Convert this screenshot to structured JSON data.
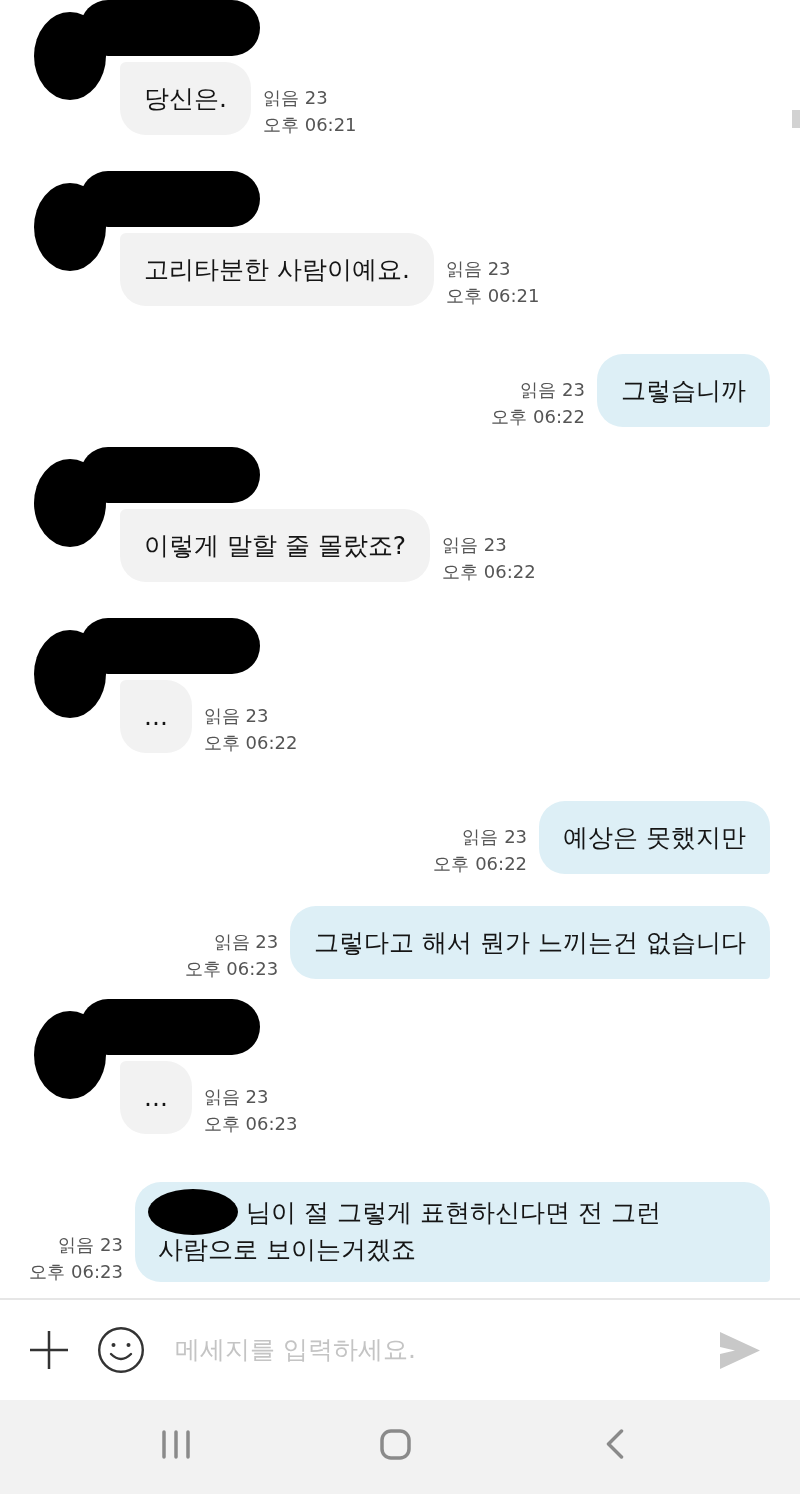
{
  "messages": [
    {
      "kind": "received",
      "lines": [
        "당신은."
      ],
      "read": "읽음 23",
      "time": "오후 06:21",
      "redacted_name_prefix": false
    },
    {
      "kind": "received",
      "lines": [
        "고리타분한 사람이예요."
      ],
      "read": "읽음 23",
      "time": "오후 06:21",
      "redacted_name_prefix": false
    },
    {
      "kind": "sent",
      "lines": [
        "그렇습니까"
      ],
      "read": "읽음 23",
      "time": "오후 06:22",
      "redacted_name_prefix": false
    },
    {
      "kind": "received",
      "lines": [
        "이렇게 말할 줄 몰랐죠?"
      ],
      "read": "읽음 23",
      "time": "오후 06:22",
      "redacted_name_prefix": false
    },
    {
      "kind": "received",
      "lines": [
        "..."
      ],
      "read": "읽음 23",
      "time": "오후 06:22",
      "redacted_name_prefix": false
    },
    {
      "kind": "sent",
      "lines": [
        "예상은 못했지만"
      ],
      "read": "읽음 23",
      "time": "오후 06:22",
      "redacted_name_prefix": false
    },
    {
      "kind": "sent",
      "lines": [
        "그렇다고 해서 뭔가 느끼는건 없습니다"
      ],
      "read": "읽음 23",
      "time": "오후 06:23",
      "redacted_name_prefix": false
    },
    {
      "kind": "received",
      "lines": [
        "..."
      ],
      "read": "읽음 23",
      "time": "오후 06:23",
      "redacted_name_prefix": false
    },
    {
      "kind": "sent",
      "lines": [
        "님이 절 그렇게 표현하신다면 전 그런",
        "사람으로 보이는거겠죠"
      ],
      "read": "읽음 23",
      "time": "오후 06:23",
      "redacted_name_prefix": true
    }
  ],
  "composer": {
    "placeholder": "메세지를 입력하세요."
  }
}
